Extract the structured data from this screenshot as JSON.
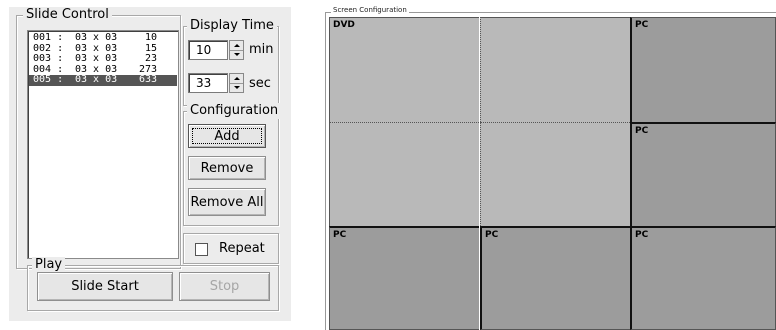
{
  "slide_control": {
    "title": "Slide Control",
    "slides": [
      {
        "id": "001 :",
        "grid": "03 x 03",
        "time": "10",
        "selected": false
      },
      {
        "id": "002 :",
        "grid": "03 x 03",
        "time": "15",
        "selected": false
      },
      {
        "id": "003 :",
        "grid": "03 x 03",
        "time": "23",
        "selected": false
      },
      {
        "id": "004 :",
        "grid": "03 x 03",
        "time": "273",
        "selected": false
      },
      {
        "id": "005 :",
        "grid": "03 x 03",
        "time": "633",
        "selected": true
      }
    ]
  },
  "display_time": {
    "title": "Display Time",
    "minutes": "10",
    "minutes_unit": "min",
    "seconds": "33",
    "seconds_unit": "sec"
  },
  "configuration": {
    "title": "Configuration",
    "add_label": "Add",
    "remove_label": "Remove",
    "remove_all_label": "Remove All"
  },
  "repeat": {
    "label": "Repeat",
    "checked": false
  },
  "play": {
    "title": "Play",
    "slide_start_label": "Slide Start",
    "stop_label": "Stop"
  },
  "screen_config": {
    "title": "Screen Configuration",
    "cells": [
      {
        "label": "DVD"
      },
      {
        "label": ""
      },
      {
        "label": "PC"
      },
      {
        "label": ""
      },
      {
        "label": ""
      },
      {
        "label": "PC"
      },
      {
        "label": "PC"
      },
      {
        "label": "PC"
      },
      {
        "label": "PC"
      }
    ]
  },
  "colors": {
    "panel_bg": "#ececec",
    "dvd_region": "#b9b9b9",
    "pc_region": "#9c9c9c",
    "selected_row": "#555555"
  }
}
